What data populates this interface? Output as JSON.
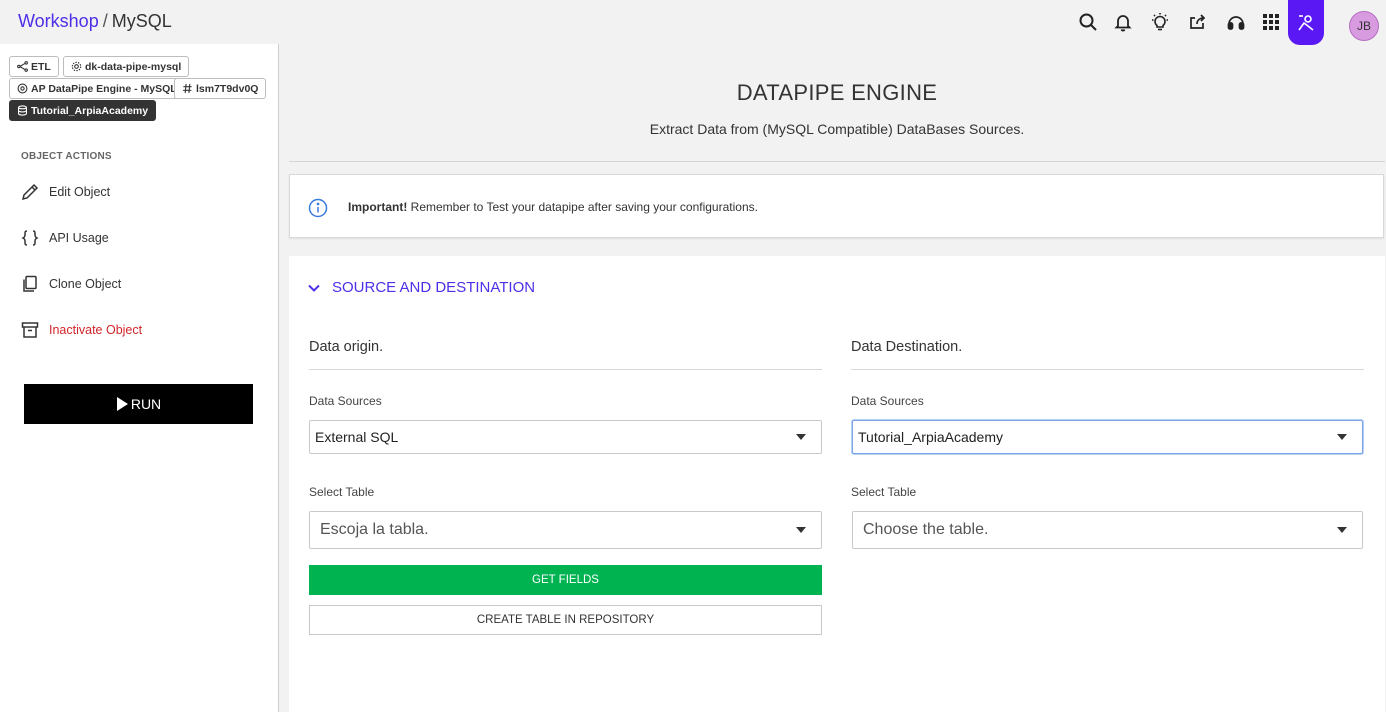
{
  "header": {
    "breadcrumb_link": "Workshop",
    "breadcrumb_sep": "/",
    "breadcrumb_current": "MySQL",
    "avatar_initials": "JB",
    "icons": [
      "search-icon",
      "bell-icon",
      "lightbulb-icon",
      "share-icon",
      "headset-icon",
      "apps-grid-icon",
      "user-agent-icon"
    ],
    "accent_color": "#5a18f5"
  },
  "sidebar": {
    "tags": [
      {
        "label": "ETL",
        "icon": "etl-icon"
      },
      {
        "label": "dk-data-pipe-mysql",
        "icon": "gear-icon"
      },
      {
        "label": "AP DataPipe Engine - MySQL",
        "icon": "engine-icon"
      },
      {
        "label": "lsm7T9dv0Q",
        "icon": "hash-icon"
      },
      {
        "label": "Tutorial_ArpiaAcademy",
        "icon": "database-icon"
      }
    ],
    "section_label": "OBJECT ACTIONS",
    "actions": [
      {
        "label": "Edit Object",
        "icon": "pencil-icon"
      },
      {
        "label": "API Usage",
        "icon": "braces-icon"
      },
      {
        "label": "Clone Object",
        "icon": "copy-icon"
      },
      {
        "label": "Inactivate Object",
        "icon": "archive-icon",
        "color": "#d0262b"
      }
    ],
    "run_label": "RUN"
  },
  "main": {
    "title": "DATAPIPE ENGINE",
    "subtitle": "Extract Data from (MySQL Compatible) DataBases Sources.",
    "notice_bold": "Important!",
    "notice_text": " Remember to Test your datapipe after saving your configurations.",
    "section_title": "SOURCE AND DESTINATION",
    "origin": {
      "title": "Data origin.",
      "data_sources_label": "Data Sources",
      "data_sources_value": "External SQL",
      "select_table_label": "Select Table",
      "select_table_placeholder": "Escoja la tabla.",
      "get_fields_label": "GET FIELDS",
      "create_table_label": "CREATE TABLE IN REPOSITORY"
    },
    "destination": {
      "title": "Data Destination.",
      "data_sources_label": "Data Sources",
      "data_sources_value": "Tutorial_ArpiaAcademy",
      "select_table_label": "Select Table",
      "select_table_placeholder": "Choose the table."
    },
    "colors": {
      "link": "#4f2ee8",
      "success": "#00b351",
      "danger": "#d0262b"
    }
  }
}
